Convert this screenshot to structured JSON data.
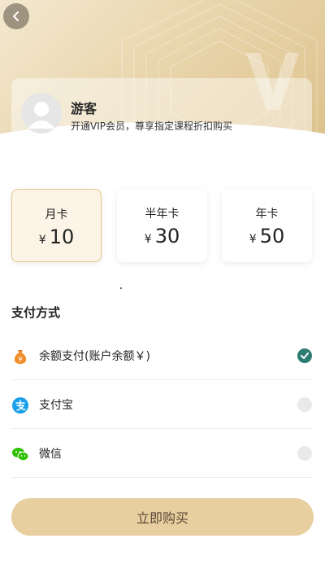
{
  "header": {
    "back_icon": "chevron-left-icon",
    "watermark_text": "VIP"
  },
  "profile": {
    "name": "游客",
    "subtitle": "开通VIP会员，尊享指定课程折扣购买",
    "avatar_icon": "user-avatar-icon"
  },
  "plans": [
    {
      "name": "月卡",
      "currency": "¥",
      "price": "10",
      "selected": true
    },
    {
      "name": "半年卡",
      "currency": "¥",
      "price": "30",
      "selected": false
    },
    {
      "name": "年卡",
      "currency": "¥",
      "price": "50",
      "selected": false
    }
  ],
  "payment": {
    "title": "支付方式",
    "methods": [
      {
        "label": "余额支付(账户余额￥)",
        "icon": "wallet-bag-icon",
        "checked": true
      },
      {
        "label": "支付宝",
        "icon": "alipay-icon",
        "checked": false
      },
      {
        "label": "微信",
        "icon": "wechat-icon",
        "checked": false
      }
    ]
  },
  "buy_button": {
    "label": "立即购买"
  },
  "colors": {
    "accent_gold": "#e8cfa0",
    "check_green": "#2e7d72",
    "selected_card_bg": "#fcf4e6"
  }
}
